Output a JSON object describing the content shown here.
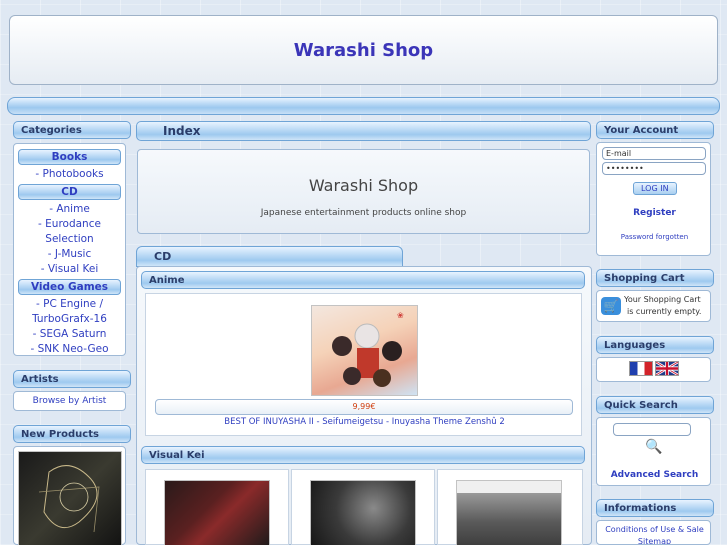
{
  "site": {
    "title": "Warashi Shop"
  },
  "categories": {
    "heading": "Categories",
    "groups": [
      {
        "label": "Books",
        "items": [
          "- Photobooks"
        ]
      },
      {
        "label": "CD",
        "items": [
          "- Anime",
          "- Eurodance",
          "Selection",
          "- J-Music",
          "- Visual Kei"
        ]
      },
      {
        "label": "Video Games",
        "items": [
          "- PC Engine /",
          "TurboGrafx-16",
          "- SEGA Saturn",
          "- SNK Neo-Geo"
        ]
      }
    ]
  },
  "artists": {
    "heading": "Artists",
    "link": "Browse by Artist"
  },
  "new_products": {
    "heading": "New Products"
  },
  "index": {
    "heading": "Index",
    "shop_title": "Warashi Shop",
    "subtitle": "Japanese entertainment products online shop"
  },
  "cd_section": {
    "tab": "CD",
    "anime": {
      "heading": "Anime",
      "product": {
        "price": "9,99€",
        "title": "BEST OF INUYASHA II - Seifumeigetsu - Inuyasha Theme Zenshû 2"
      }
    },
    "visual_kei": {
      "heading": "Visual Kei"
    }
  },
  "account": {
    "heading": "Your Account",
    "email_value": "E-mail",
    "password_value": "••••••••",
    "login_button": "LOG IN",
    "register": "Register",
    "forgot": "Password forgotten"
  },
  "cart": {
    "heading": "Shopping Cart",
    "line1": "Your Shopping Cart",
    "line2": "is currently empty."
  },
  "languages": {
    "heading": "Languages"
  },
  "quick_search": {
    "heading": "Quick Search",
    "advanced": "Advanced Search"
  },
  "informations": {
    "heading": "Informations",
    "items": [
      "Conditions of Use & Sale",
      "Sitemap"
    ]
  },
  "colors": {
    "brand": "#3b35b8",
    "link": "#2f3ec0",
    "price": "#d04010"
  }
}
